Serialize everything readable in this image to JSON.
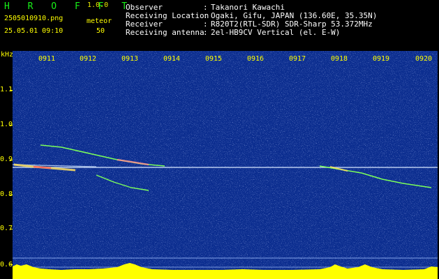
{
  "app": {
    "name": "H R O F F T",
    "version": "1.0.0"
  },
  "file": {
    "name": "2505010910.png",
    "datetime": "25.05.01 09:10"
  },
  "detection": {
    "label": "meteor",
    "count": "50"
  },
  "meta": [
    {
      "key": "Observer",
      "value": "Takanori Kawachi"
    },
    {
      "key": "Receiving Location",
      "value": "Ogaki, Gifu, JAPAN (136.60E, 35.35N)"
    },
    {
      "key": "Receiver",
      "value": "R820T2(RTL-SDR) SDR-Sharp 53.372MHz"
    },
    {
      "key": "Receiving antenna",
      "value": "2el-HB9CV Vertical (el. E-W)"
    }
  ],
  "axis": {
    "unit": "kHz",
    "y_ticks": [
      "1.1",
      "1.0",
      "0.9",
      "0.8",
      "0.7",
      "0.6"
    ],
    "x_ticks": [
      "0911",
      "0912",
      "0913",
      "0914",
      "0915",
      "0916",
      "0917",
      "0918",
      "0919",
      "0920"
    ]
  },
  "colors": {
    "background": "#0b2d8f",
    "label": "#ffff00",
    "title": "#18f018",
    "signal": "#ffffff",
    "echo": "#7cff5a"
  }
}
